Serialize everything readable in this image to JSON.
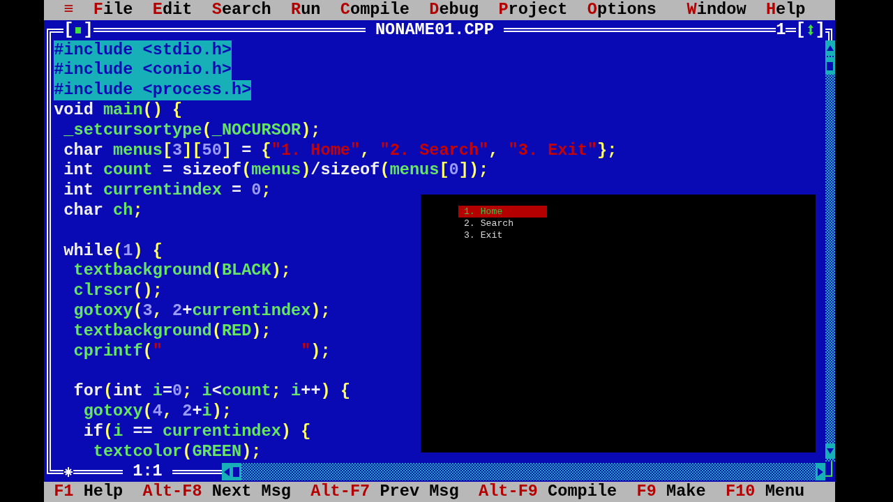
{
  "menu_bar": {
    "system_menu": "≡",
    "items": [
      {
        "label": "File"
      },
      {
        "label": "Edit"
      },
      {
        "label": "Search"
      },
      {
        "label": "Run"
      },
      {
        "label": "Compile"
      },
      {
        "label": "Debug"
      },
      {
        "label": "Project"
      },
      {
        "label": "Options"
      }
    ],
    "right_items": [
      {
        "label": "Window"
      },
      {
        "label": "Help"
      }
    ]
  },
  "editor": {
    "close_button": {
      "left": "[",
      "right": "]"
    },
    "window_title": "NONAME01.CPP",
    "window_number": "1",
    "zoom_button": {
      "left": "[",
      "right": "]"
    },
    "cursor_position": "1:1",
    "lines": [
      {
        "kind": "code",
        "selected": true,
        "tokens": [
          {
            "kind": "directive",
            "text": "#include <stdio.h>"
          }
        ]
      },
      {
        "kind": "code",
        "selected": true,
        "tokens": [
          {
            "kind": "directive",
            "text": "#include <conio.h>"
          }
        ]
      },
      {
        "kind": "code",
        "selected": true,
        "tokens": [
          {
            "kind": "directive",
            "text": "#include <process.h>"
          }
        ]
      },
      {
        "kind": "code",
        "selected": false,
        "tokens": [
          {
            "kind": "plain",
            "text": "void "
          },
          {
            "kind": "ident",
            "text": "main"
          },
          {
            "kind": "punct",
            "text": "() {"
          }
        ]
      },
      {
        "kind": "code",
        "selected": false,
        "tokens": [
          {
            "kind": "ident",
            "text": " _setcursortype"
          },
          {
            "kind": "punct",
            "text": "("
          },
          {
            "kind": "ident",
            "text": "_NOCURSOR"
          },
          {
            "kind": "punct",
            "text": ");"
          }
        ]
      },
      {
        "kind": "code",
        "selected": false,
        "tokens": [
          {
            "kind": "plain",
            "text": " char "
          },
          {
            "kind": "ident",
            "text": "menus"
          },
          {
            "kind": "punct",
            "text": "["
          },
          {
            "kind": "number",
            "text": "3"
          },
          {
            "kind": "punct",
            "text": "]["
          },
          {
            "kind": "number",
            "text": "50"
          },
          {
            "kind": "punct",
            "text": "] "
          },
          {
            "kind": "plain",
            "text": "= "
          },
          {
            "kind": "punct",
            "text": "{"
          },
          {
            "kind": "string",
            "text": "\"1. Home\""
          },
          {
            "kind": "punct",
            "text": ", "
          },
          {
            "kind": "string",
            "text": "\"2. Search\""
          },
          {
            "kind": "punct",
            "text": ", "
          },
          {
            "kind": "string",
            "text": "\"3. Exit\""
          },
          {
            "kind": "punct",
            "text": "};"
          }
        ]
      },
      {
        "kind": "code",
        "selected": false,
        "tokens": [
          {
            "kind": "plain",
            "text": " int "
          },
          {
            "kind": "ident",
            "text": "count "
          },
          {
            "kind": "plain",
            "text": "= sizeof"
          },
          {
            "kind": "punct",
            "text": "("
          },
          {
            "kind": "ident",
            "text": "menus"
          },
          {
            "kind": "punct",
            "text": ")"
          },
          {
            "kind": "plain",
            "text": "/sizeof"
          },
          {
            "kind": "punct",
            "text": "("
          },
          {
            "kind": "ident",
            "text": "menus"
          },
          {
            "kind": "punct",
            "text": "["
          },
          {
            "kind": "number",
            "text": "0"
          },
          {
            "kind": "punct",
            "text": "]);"
          }
        ]
      },
      {
        "kind": "code",
        "selected": false,
        "tokens": [
          {
            "kind": "plain",
            "text": " int "
          },
          {
            "kind": "ident",
            "text": "currentindex "
          },
          {
            "kind": "plain",
            "text": "= "
          },
          {
            "kind": "number",
            "text": "0"
          },
          {
            "kind": "punct",
            "text": ";"
          }
        ]
      },
      {
        "kind": "code",
        "selected": false,
        "tokens": [
          {
            "kind": "plain",
            "text": " char "
          },
          {
            "kind": "ident",
            "text": "ch"
          },
          {
            "kind": "punct",
            "text": ";"
          }
        ]
      },
      {
        "kind": "blank",
        "selected": false
      },
      {
        "kind": "code",
        "selected": false,
        "tokens": [
          {
            "kind": "plain",
            "text": " while"
          },
          {
            "kind": "punct",
            "text": "("
          },
          {
            "kind": "number",
            "text": "1"
          },
          {
            "kind": "punct",
            "text": ") {"
          }
        ]
      },
      {
        "kind": "code",
        "selected": false,
        "tokens": [
          {
            "kind": "ident",
            "text": "  textbackground"
          },
          {
            "kind": "punct",
            "text": "("
          },
          {
            "kind": "ident",
            "text": "BLACK"
          },
          {
            "kind": "punct",
            "text": ");"
          }
        ]
      },
      {
        "kind": "code",
        "selected": false,
        "tokens": [
          {
            "kind": "ident",
            "text": "  clrscr"
          },
          {
            "kind": "punct",
            "text": "();"
          }
        ]
      },
      {
        "kind": "code",
        "selected": false,
        "tokens": [
          {
            "kind": "ident",
            "text": "  gotoxy"
          },
          {
            "kind": "punct",
            "text": "("
          },
          {
            "kind": "number",
            "text": "3"
          },
          {
            "kind": "punct",
            "text": ", "
          },
          {
            "kind": "number",
            "text": "2"
          },
          {
            "kind": "plain",
            "text": "+"
          },
          {
            "kind": "ident",
            "text": "currentindex"
          },
          {
            "kind": "punct",
            "text": ");"
          }
        ]
      },
      {
        "kind": "code",
        "selected": false,
        "tokens": [
          {
            "kind": "ident",
            "text": "  textbackground"
          },
          {
            "kind": "punct",
            "text": "("
          },
          {
            "kind": "ident",
            "text": "RED"
          },
          {
            "kind": "punct",
            "text": ");"
          }
        ]
      },
      {
        "kind": "code",
        "selected": false,
        "tokens": [
          {
            "kind": "ident",
            "text": "  cprintf"
          },
          {
            "kind": "punct",
            "text": "("
          },
          {
            "kind": "string",
            "text": "\"              \""
          },
          {
            "kind": "punct",
            "text": ");"
          }
        ]
      },
      {
        "kind": "blank",
        "selected": false
      },
      {
        "kind": "code",
        "selected": false,
        "tokens": [
          {
            "kind": "plain",
            "text": "  for"
          },
          {
            "kind": "punct",
            "text": "("
          },
          {
            "kind": "plain",
            "text": "int "
          },
          {
            "kind": "ident",
            "text": "i"
          },
          {
            "kind": "plain",
            "text": "="
          },
          {
            "kind": "number",
            "text": "0"
          },
          {
            "kind": "punct",
            "text": "; "
          },
          {
            "kind": "ident",
            "text": "i"
          },
          {
            "kind": "plain",
            "text": "<"
          },
          {
            "kind": "ident",
            "text": "count"
          },
          {
            "kind": "punct",
            "text": "; "
          },
          {
            "kind": "ident",
            "text": "i"
          },
          {
            "kind": "plain",
            "text": "++"
          },
          {
            "kind": "punct",
            "text": ") {"
          }
        ]
      },
      {
        "kind": "code",
        "selected": false,
        "tokens": [
          {
            "kind": "ident",
            "text": "   gotoxy"
          },
          {
            "kind": "punct",
            "text": "("
          },
          {
            "kind": "number",
            "text": "4"
          },
          {
            "kind": "punct",
            "text": ", "
          },
          {
            "kind": "number",
            "text": "2"
          },
          {
            "kind": "plain",
            "text": "+"
          },
          {
            "kind": "ident",
            "text": "i"
          },
          {
            "kind": "punct",
            "text": ");"
          }
        ]
      },
      {
        "kind": "code",
        "selected": false,
        "tokens": [
          {
            "kind": "plain",
            "text": "   if"
          },
          {
            "kind": "punct",
            "text": "("
          },
          {
            "kind": "ident",
            "text": "i "
          },
          {
            "kind": "plain",
            "text": "== "
          },
          {
            "kind": "ident",
            "text": "currentindex"
          },
          {
            "kind": "punct",
            "text": ") {"
          }
        ]
      },
      {
        "kind": "code",
        "selected": false,
        "tokens": [
          {
            "kind": "ident",
            "text": "    textcolor"
          },
          {
            "kind": "punct",
            "text": "("
          },
          {
            "kind": "ident",
            "text": "GREEN"
          },
          {
            "kind": "punct",
            "text": ");"
          }
        ]
      }
    ]
  },
  "output_window": {
    "items": [
      {
        "text": "1. Home",
        "selected": true
      },
      {
        "text": "2. Search",
        "selected": false
      },
      {
        "text": "3. Exit",
        "selected": false
      }
    ]
  },
  "status_bar": {
    "items": [
      {
        "key": "F1",
        "label": "Help"
      },
      {
        "key": "Alt-F8",
        "label": "Next Msg"
      },
      {
        "key": "Alt-F7",
        "label": "Prev Msg"
      },
      {
        "key": "Alt-F9",
        "label": "Compile"
      },
      {
        "key": "F9",
        "label": "Make"
      },
      {
        "key": "F10",
        "label": "Menu"
      }
    ]
  }
}
